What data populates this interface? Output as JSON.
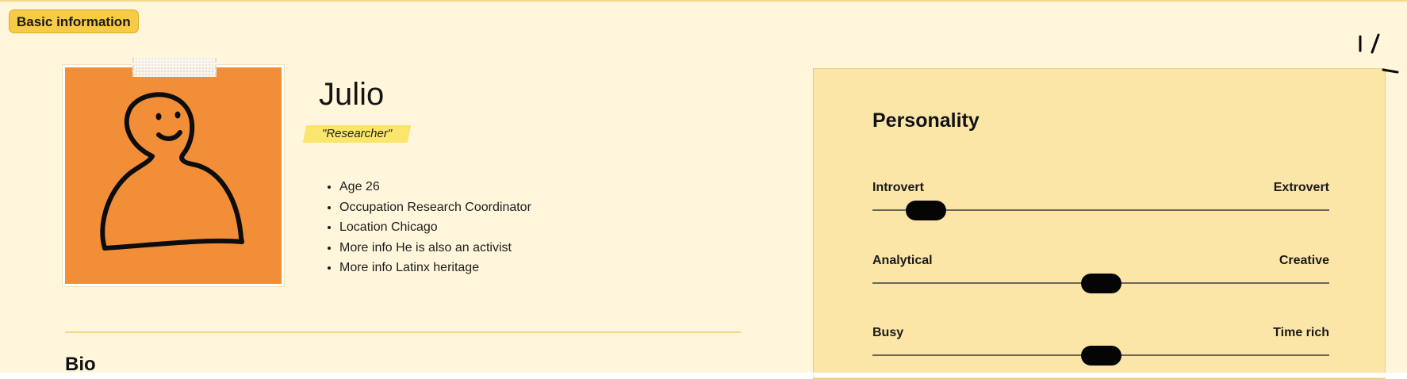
{
  "section": {
    "badge_label": "Basic information"
  },
  "persona": {
    "name": "Julio",
    "tagline": "\"Researcher\"",
    "photo_icon": "hand-drawn-person-icon",
    "facts": [
      "Age 26",
      "Occupation Research Coordinator",
      "Location Chicago",
      "More info He is also an activist",
      "More info Latinx heritage"
    ]
  },
  "bio": {
    "heading": "Bio"
  },
  "personality": {
    "title": "Personality",
    "sliders": [
      {
        "left": "Introvert",
        "right": "Extrovert",
        "value": 0.08
      },
      {
        "left": "Analytical",
        "right": "Creative",
        "value": 0.5
      },
      {
        "left": "Busy",
        "right": "Time rich",
        "value": 0.5
      }
    ]
  },
  "colors": {
    "page_background": "#fff6dc",
    "badge": "#f7cb45",
    "photo_background": "#f28e37",
    "tagline_highlight": "#fbe56d",
    "personality_card": "#fbe6a8",
    "slider_thumb": "#050505"
  },
  "decorations": {
    "corner_marks_icon": "sparkle-marks-icon",
    "tape_icon": "tape-icon"
  }
}
